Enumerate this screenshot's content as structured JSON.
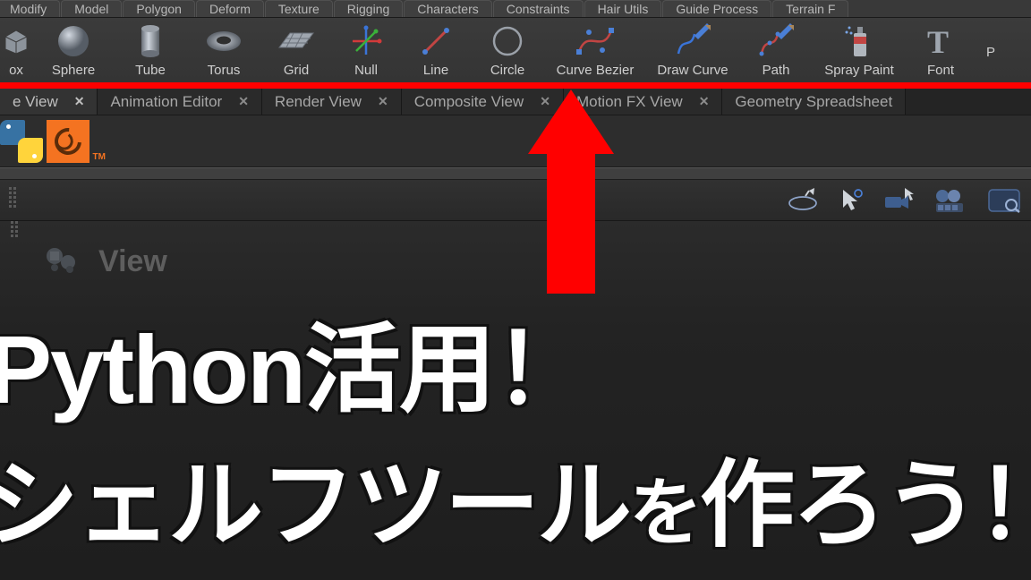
{
  "menu": {
    "items": [
      "Modify",
      "Model",
      "Polygon",
      "Deform",
      "Texture",
      "Rigging",
      "Characters",
      "Constraints",
      "Hair Utils",
      "Guide Process",
      "Terrain F"
    ]
  },
  "shelf": {
    "tools": [
      {
        "label": "ox"
      },
      {
        "label": "Sphere"
      },
      {
        "label": "Tube"
      },
      {
        "label": "Torus"
      },
      {
        "label": "Grid"
      },
      {
        "label": "Null"
      },
      {
        "label": "Line"
      },
      {
        "label": "Circle"
      },
      {
        "label": "Curve Bezier"
      },
      {
        "label": "Draw Curve"
      },
      {
        "label": "Path"
      },
      {
        "label": "Spray Paint"
      },
      {
        "label": "Font"
      }
    ],
    "edge_right_label": "P"
  },
  "tabs": [
    {
      "label": "e View",
      "active": true
    },
    {
      "label": "Animation Editor",
      "active": false
    },
    {
      "label": "Render View",
      "active": false
    },
    {
      "label": "Composite View",
      "active": false
    },
    {
      "label": "Motion FX View",
      "active": false
    },
    {
      "label": "Geometry Spreadsheet",
      "active": false
    }
  ],
  "houdini_tm": "TM",
  "viewport": {
    "view_label": "View"
  },
  "overlay": {
    "line1": "Python活用！",
    "line2a": "シェルフツール",
    "line2b": "を",
    "line2c": "作ろう！"
  }
}
